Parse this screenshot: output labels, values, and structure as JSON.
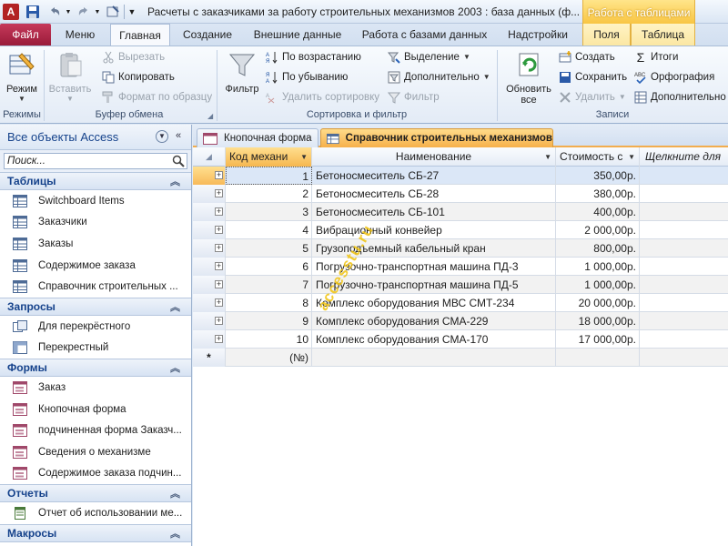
{
  "window": {
    "title": "Расчеты с заказчиками за работу строительных механизмов 2003 : база данных (ф...",
    "context_title": "Работа с таблицами"
  },
  "ribbon_tabs": [
    "Файл",
    "Меню",
    "Главная",
    "Создание",
    "Внешние данные",
    "Работа с базами данных",
    "Надстройки",
    "Поля",
    "Таблица"
  ],
  "ribbon": {
    "groups": {
      "views": "Режимы",
      "clipboard": "Буфер обмена",
      "sort_filter": "Сортировка и фильтр",
      "records": "Записи"
    },
    "view_label": "Режим",
    "paste_label": "Вставить",
    "cut_label": "Вырезать",
    "copy_label": "Копировать",
    "format_painter_label": "Формат по образцу",
    "filter_label": "Фильтр",
    "sort_asc_label": "По возрастанию",
    "sort_desc_label": "По убыванию",
    "remove_sort_label": "Удалить сортировку",
    "selection_label": "Выделение",
    "advanced_label": "Дополнительно",
    "toggle_filter_label": "Фильтр",
    "refresh_label_1": "Обновить",
    "refresh_label_2": "все",
    "new_label": "Создать",
    "save_label": "Сохранить",
    "delete_label": "Удалить",
    "totals_label": "Итоги",
    "spelling_label": "Орфография",
    "more_label": "Дополнительно"
  },
  "nav": {
    "header": "Все объекты Access",
    "search_placeholder": "Поиск...",
    "sections": [
      {
        "title": "Таблицы",
        "items": [
          "Switchboard Items",
          "Заказчики",
          "Заказы",
          "Содержимое заказа",
          "Справочник строительных ..."
        ]
      },
      {
        "title": "Запросы",
        "items": [
          "Для перекрёстного",
          "Перекрестный"
        ]
      },
      {
        "title": "Формы",
        "items": [
          "Заказ",
          "Кнопочная форма",
          "подчиненная форма Заказч...",
          "Сведения о механизме",
          "Содержимое заказа подчин..."
        ]
      },
      {
        "title": "Отчеты",
        "items": [
          "Отчет об использовании ме..."
        ]
      },
      {
        "title": "Макросы",
        "items": []
      }
    ]
  },
  "doc_tabs": [
    "Кнопочная форма",
    "Справочник строительных механизмов"
  ],
  "table": {
    "columns": [
      "Код механи",
      "Наименование",
      "Стоимость с",
      "Щелкните для"
    ],
    "rows": [
      {
        "id": "1",
        "name": "Бетоносмеситель СБ-27",
        "cost": "350,00р."
      },
      {
        "id": "2",
        "name": "Бетоносмеситель СБ-28",
        "cost": "380,00р."
      },
      {
        "id": "3",
        "name": "Бетоносмеситель СБ-101",
        "cost": "400,00р."
      },
      {
        "id": "4",
        "name": "Вибрационный конвейер",
        "cost": "2 000,00р."
      },
      {
        "id": "5",
        "name": "Грузоподъемный кабельный кран",
        "cost": "800,00р."
      },
      {
        "id": "6",
        "name": "Погрузочно-транспортная машина ПД-3",
        "cost": "1 000,00р."
      },
      {
        "id": "7",
        "name": "Погрузочно-транспортная машина ПД-5",
        "cost": "1 000,00р."
      },
      {
        "id": "8",
        "name": "Комплекс оборудования МВС СМТ-234",
        "cost": "20 000,00р."
      },
      {
        "id": "9",
        "name": "Комплекс оборудования  СМА-229",
        "cost": "18 000,00р."
      },
      {
        "id": "10",
        "name": "Комплекс оборудования  СМА-170",
        "cost": "17 000,00р."
      }
    ],
    "new_row_marker": "*",
    "new_row_id": "(№)"
  },
  "watermark": "accesstu.ru",
  "colors": {
    "accent": "#f6b04a",
    "file_tab": "#b0284a",
    "nav_text": "#15428b"
  }
}
